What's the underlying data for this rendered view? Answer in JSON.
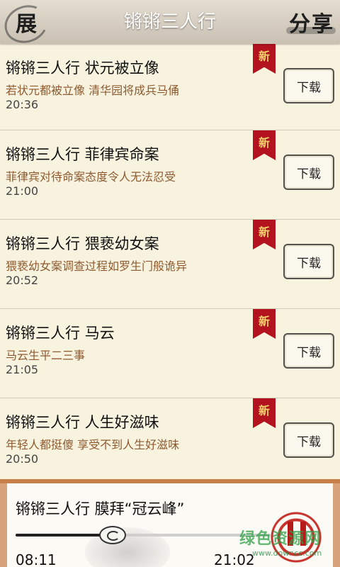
{
  "header": {
    "left_label": "展",
    "title": "锵锵三人行",
    "right_label": "分享"
  },
  "items": [
    {
      "title": "锵锵三人行 状元被立像",
      "desc": "若状元都被立像 清华园将成兵马俑",
      "time": "20:36",
      "badge": "新",
      "download_label": "下载"
    },
    {
      "title": "锵锵三人行 菲律宾命案",
      "desc": "菲律宾对待命案态度令人无法忍受",
      "time": "21:00",
      "badge": "新",
      "download_label": "下载"
    },
    {
      "title": "锵锵三人行 猥亵幼女案",
      "desc": "猥亵幼女案调查过程如罗生门般诡异",
      "time": "20:52",
      "badge": "新",
      "download_label": "下载"
    },
    {
      "title": "锵锵三人行 马云",
      "desc": "马云生平二三事",
      "time": "21:05",
      "badge": "新",
      "download_label": "下载"
    },
    {
      "title": "锵锵三人行 人生好滋味",
      "desc": "年轻人都挺傻 享受不到人生好滋味",
      "time": "20:50",
      "badge": "新",
      "download_label": "下载"
    }
  ],
  "player": {
    "now_playing": "锵锵三人行 膜拜“冠云峰”",
    "current_time": "08:11",
    "total_time": "21:02",
    "progress": 0.38
  },
  "watermark": {
    "text": "绿色资源网",
    "url": "www.downcc.com"
  },
  "colors": {
    "badge": "#b3121f",
    "desc_text": "#8e5a30",
    "pause_icon": "#b81a1a"
  }
}
